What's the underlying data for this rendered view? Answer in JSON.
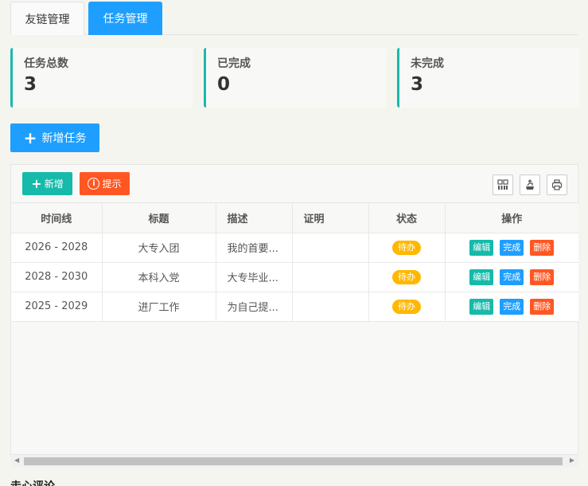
{
  "tabs": [
    {
      "label": "友链管理",
      "active": false
    },
    {
      "label": "任务管理",
      "active": true
    }
  ],
  "stats": [
    {
      "label": "任务总数",
      "value": "3"
    },
    {
      "label": "已完成",
      "value": "0"
    },
    {
      "label": "未完成",
      "value": "3"
    }
  ],
  "add_task_label": "新增任务",
  "toolbar": {
    "add_label": "新增",
    "tip_label": "提示",
    "tip_icon_glyph": "i",
    "tools": [
      "columns-icon",
      "export-icon",
      "print-icon"
    ]
  },
  "table": {
    "headers": [
      "时间线",
      "标题",
      "描述",
      "证明",
      "状态",
      "操作"
    ],
    "rows": [
      {
        "timeline": "2026 - 2028",
        "title": "大专入团",
        "desc": "我的首要...",
        "proof": "",
        "status": "待办"
      },
      {
        "timeline": "2028 - 2030",
        "title": "本科入党",
        "desc": "大专毕业...",
        "proof": "",
        "status": "待办"
      },
      {
        "timeline": "2025 - 2029",
        "title": "进厂工作",
        "desc": "为自己提...",
        "proof": "",
        "status": "待办"
      }
    ],
    "actions": {
      "edit": "编辑",
      "done": "完成",
      "delete": "删除"
    }
  },
  "next_section_heading": "走心评论",
  "colors": {
    "primary": "#1e9fff",
    "teal": "#16baaa",
    "orange": "#ff5722",
    "warning": "#ffb800"
  }
}
